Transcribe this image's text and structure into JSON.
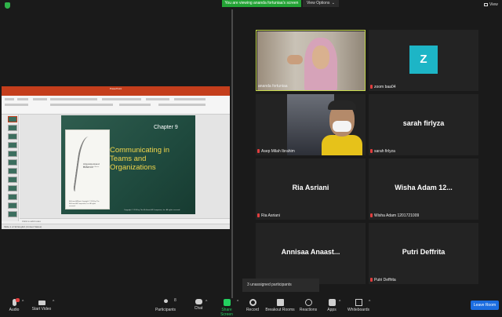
{
  "topbar": {
    "viewing_banner": "You are viewing ananda fortuniaa's screen",
    "view_options": "View Options",
    "view_options_caret": "⌄",
    "view_button": "View"
  },
  "powerpoint": {
    "window_title": "PowerPoint",
    "slide": {
      "chapter": "Chapter 9",
      "heading": "Communicating in Teams and Organizations",
      "book_title": "Organizational Behavior",
      "book_authors": "McShane / Von Glinow",
      "book_publisher": "McGraw-Hill/Irwin Copyright © 2010 by The McGraw-Hill Companies, Inc. All rights reserved.",
      "copyright": "Copyright © 2010 by The McGraw-Hill Companies, Inc. All rights reserved."
    },
    "notes_placeholder": "Click to add notes",
    "status": "Slide 1 of 32   English (United States)"
  },
  "participants": [
    {
      "name": "ananda fortuniaa",
      "video": "camera",
      "active": true
    },
    {
      "name": "zoom baa04",
      "video": "avatar",
      "avatar_letter": "Z"
    },
    {
      "name": "Asep Milah Ibrahim",
      "video": "camera"
    },
    {
      "name": "sarah firlyza",
      "display": "sarah firlyza"
    },
    {
      "name": "Ria Asriani",
      "display": "Ria Asriani"
    },
    {
      "name": "Wisha Adam 1201721009",
      "display": "Wisha Adam 12..."
    },
    {
      "name": "Annisaa Anaastasyaa",
      "display": "Annisaa Anaast..."
    },
    {
      "name": "Putri Deffrita",
      "display": "Putri Deffrita"
    }
  ],
  "unassigned": "3 unassigned participants",
  "toolbar": {
    "audio": "Audio",
    "start_video": "Start Video",
    "participants": "Participants",
    "participants_count": "8",
    "chat": "Chat",
    "share_screen": "Share Screen",
    "record": "Record",
    "breakout_rooms": "Breakout Rooms",
    "reactions": "Reactions",
    "apps": "Apps",
    "whiteboards": "Whiteboards",
    "leave": "Leave Room",
    "caret": "^"
  },
  "colors": {
    "share_green": "#23d160",
    "leave_blue": "#1c6de0",
    "ppt_orange": "#c43e1c",
    "slide_heading": "#f2d64b",
    "active_speaker": "#c6d94b"
  }
}
